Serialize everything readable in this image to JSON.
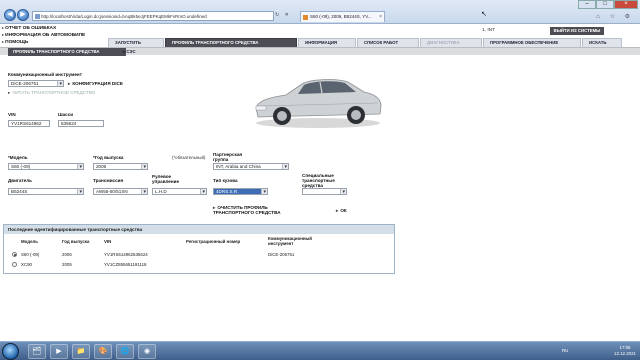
{
  "browser": {
    "address": "http://localhost/Vida/Login.do;jsessionid=bAqBk5eJjFEEPKqEMkFvRmO.undefined",
    "tab_title": "S60 (-09), 2006, B5244S, YV...",
    "tab_close": "×",
    "controls": {
      "minimize": "–",
      "maximize": "□",
      "close": "×"
    },
    "nav_back": "◀",
    "nav_forward": "▶",
    "addr_buttons": "↻ ✕",
    "right_icons": "⌂ ☆ ⚙"
  },
  "left_menu": {
    "items": [
      "ОТЧЕТ ОБ ОШИБКАХ",
      "ИНФОРМАЦИЯ ОБ АВТОМОБИЛЕ",
      "ПОМОЩЬ"
    ]
  },
  "user": {
    "label": "1, INT",
    "exit_button": "ВЫЙТИ ИЗ СИСТЕМЫ"
  },
  "main_tabs": [
    {
      "label": "ЗАПУСТИТЬ",
      "state": "normal"
    },
    {
      "label": "ПРОФИЛЬ ТРАНСПОРТНОГО СРЕДСТВА",
      "state": "active"
    },
    {
      "label": "ИНФОРМАЦИЯ",
      "state": "normal"
    },
    {
      "label": "СПИСОК РАБОТ",
      "state": "normal"
    },
    {
      "label": "ДИАГНОСТИКА",
      "state": "disabled"
    },
    {
      "label": "ПРОГРАММНОЕ ОБЕСПЕЧЕНИЕ",
      "state": "normal"
    },
    {
      "label": "ИСКАТЬ",
      "state": "normal"
    }
  ],
  "sub_tabs": {
    "active": "ПРОФИЛЬ ТРАНСПОРТНОГО СРЕДСТВА",
    "second": "СЭС"
  },
  "comm": {
    "label": "Коммуникационный инструмент",
    "value": "DiCE-206751",
    "config_link": "КОНФИГУРАЦИЯ DICE",
    "read_link": "ЧИТАТЬ ТРАНСПОРТНОЕ СРЕДСТВО"
  },
  "vin": {
    "label": "VIN",
    "value": "YV1RS614962"
  },
  "chassis": {
    "label": "Шасси",
    "value": "535624"
  },
  "form": {
    "model": {
      "label": "Модель",
      "value": "S60 (-09)"
    },
    "year": {
      "label": "Год выпуска",
      "value": "2006"
    },
    "required_hint": "(*обязательный)",
    "partner_group": {
      "label": "Партнерская группа",
      "value": "INT, Arabia and China"
    },
    "engine": {
      "label": "Двигатель",
      "value": "B5244S"
    },
    "transmission": {
      "label": "Трансмиссия",
      "value": "AW55-50/51SN"
    },
    "steering": {
      "label": "Рулевое управление",
      "value": "L.H.D"
    },
    "body": {
      "label": "Тип кузова",
      "value": "4DRS.S.R."
    },
    "special": {
      "label": "Специальные транспортные средства",
      "value": ""
    },
    "star": "*",
    "clear_link": "ОЧИСТИТЬ ПРОФИЛЬ ТРАНСПОРТНОГО СРЕДСТВА",
    "ok_link": "ОК"
  },
  "recent": {
    "title": "Последние идентифицированные транспортные средства",
    "headers": [
      "Модель",
      "Год выпуска",
      "VIN",
      "Регистрационный номер",
      "Коммуникационный инструмент"
    ],
    "rows": [
      {
        "selected": true,
        "model": "S60 (-09)",
        "year": "2006",
        "vin": "YV1RS614962535624",
        "reg": "",
        "tool": "DiCE-206751"
      },
      {
        "selected": false,
        "model": "XC90",
        "year": "2005",
        "vin": "YV1CZ855651191118",
        "reg": "",
        "tool": ""
      }
    ]
  },
  "taskbar": {
    "apps": [
      "🗂",
      "▶",
      "📁",
      "🎨",
      "🌐",
      "◉"
    ],
    "tray_lang": "RU",
    "time": "17:06",
    "date": "12.12.2021"
  },
  "colors": {
    "active_tab": "#4d4e55",
    "subbar": "#dcdde0",
    "recent_title": "#d4dee8"
  }
}
